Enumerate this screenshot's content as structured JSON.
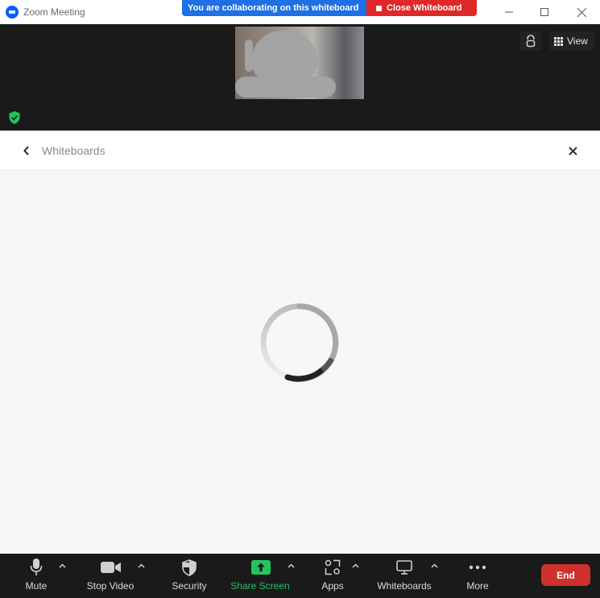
{
  "window": {
    "title": "Zoom Meeting",
    "logo_icon": "zoom-logo-icon"
  },
  "banner": {
    "text": "You are collaborating on this whiteboard",
    "close_label": "Close Whiteboard",
    "colors": {
      "info": "#1f6fe5",
      "danger": "#e02828"
    }
  },
  "video": {
    "view_label": "View",
    "security_shield_color": "#23c45e"
  },
  "whiteboards": {
    "title": "Whiteboards",
    "loading": true
  },
  "toolbar": {
    "mute": "Mute",
    "stop_video": "Stop Video",
    "security": "Security",
    "share_screen": "Share Screen",
    "apps": "Apps",
    "whiteboards": "Whiteboards",
    "more": "More",
    "end": "End",
    "share_color": "#23c45e",
    "end_color": "#d0302c"
  }
}
